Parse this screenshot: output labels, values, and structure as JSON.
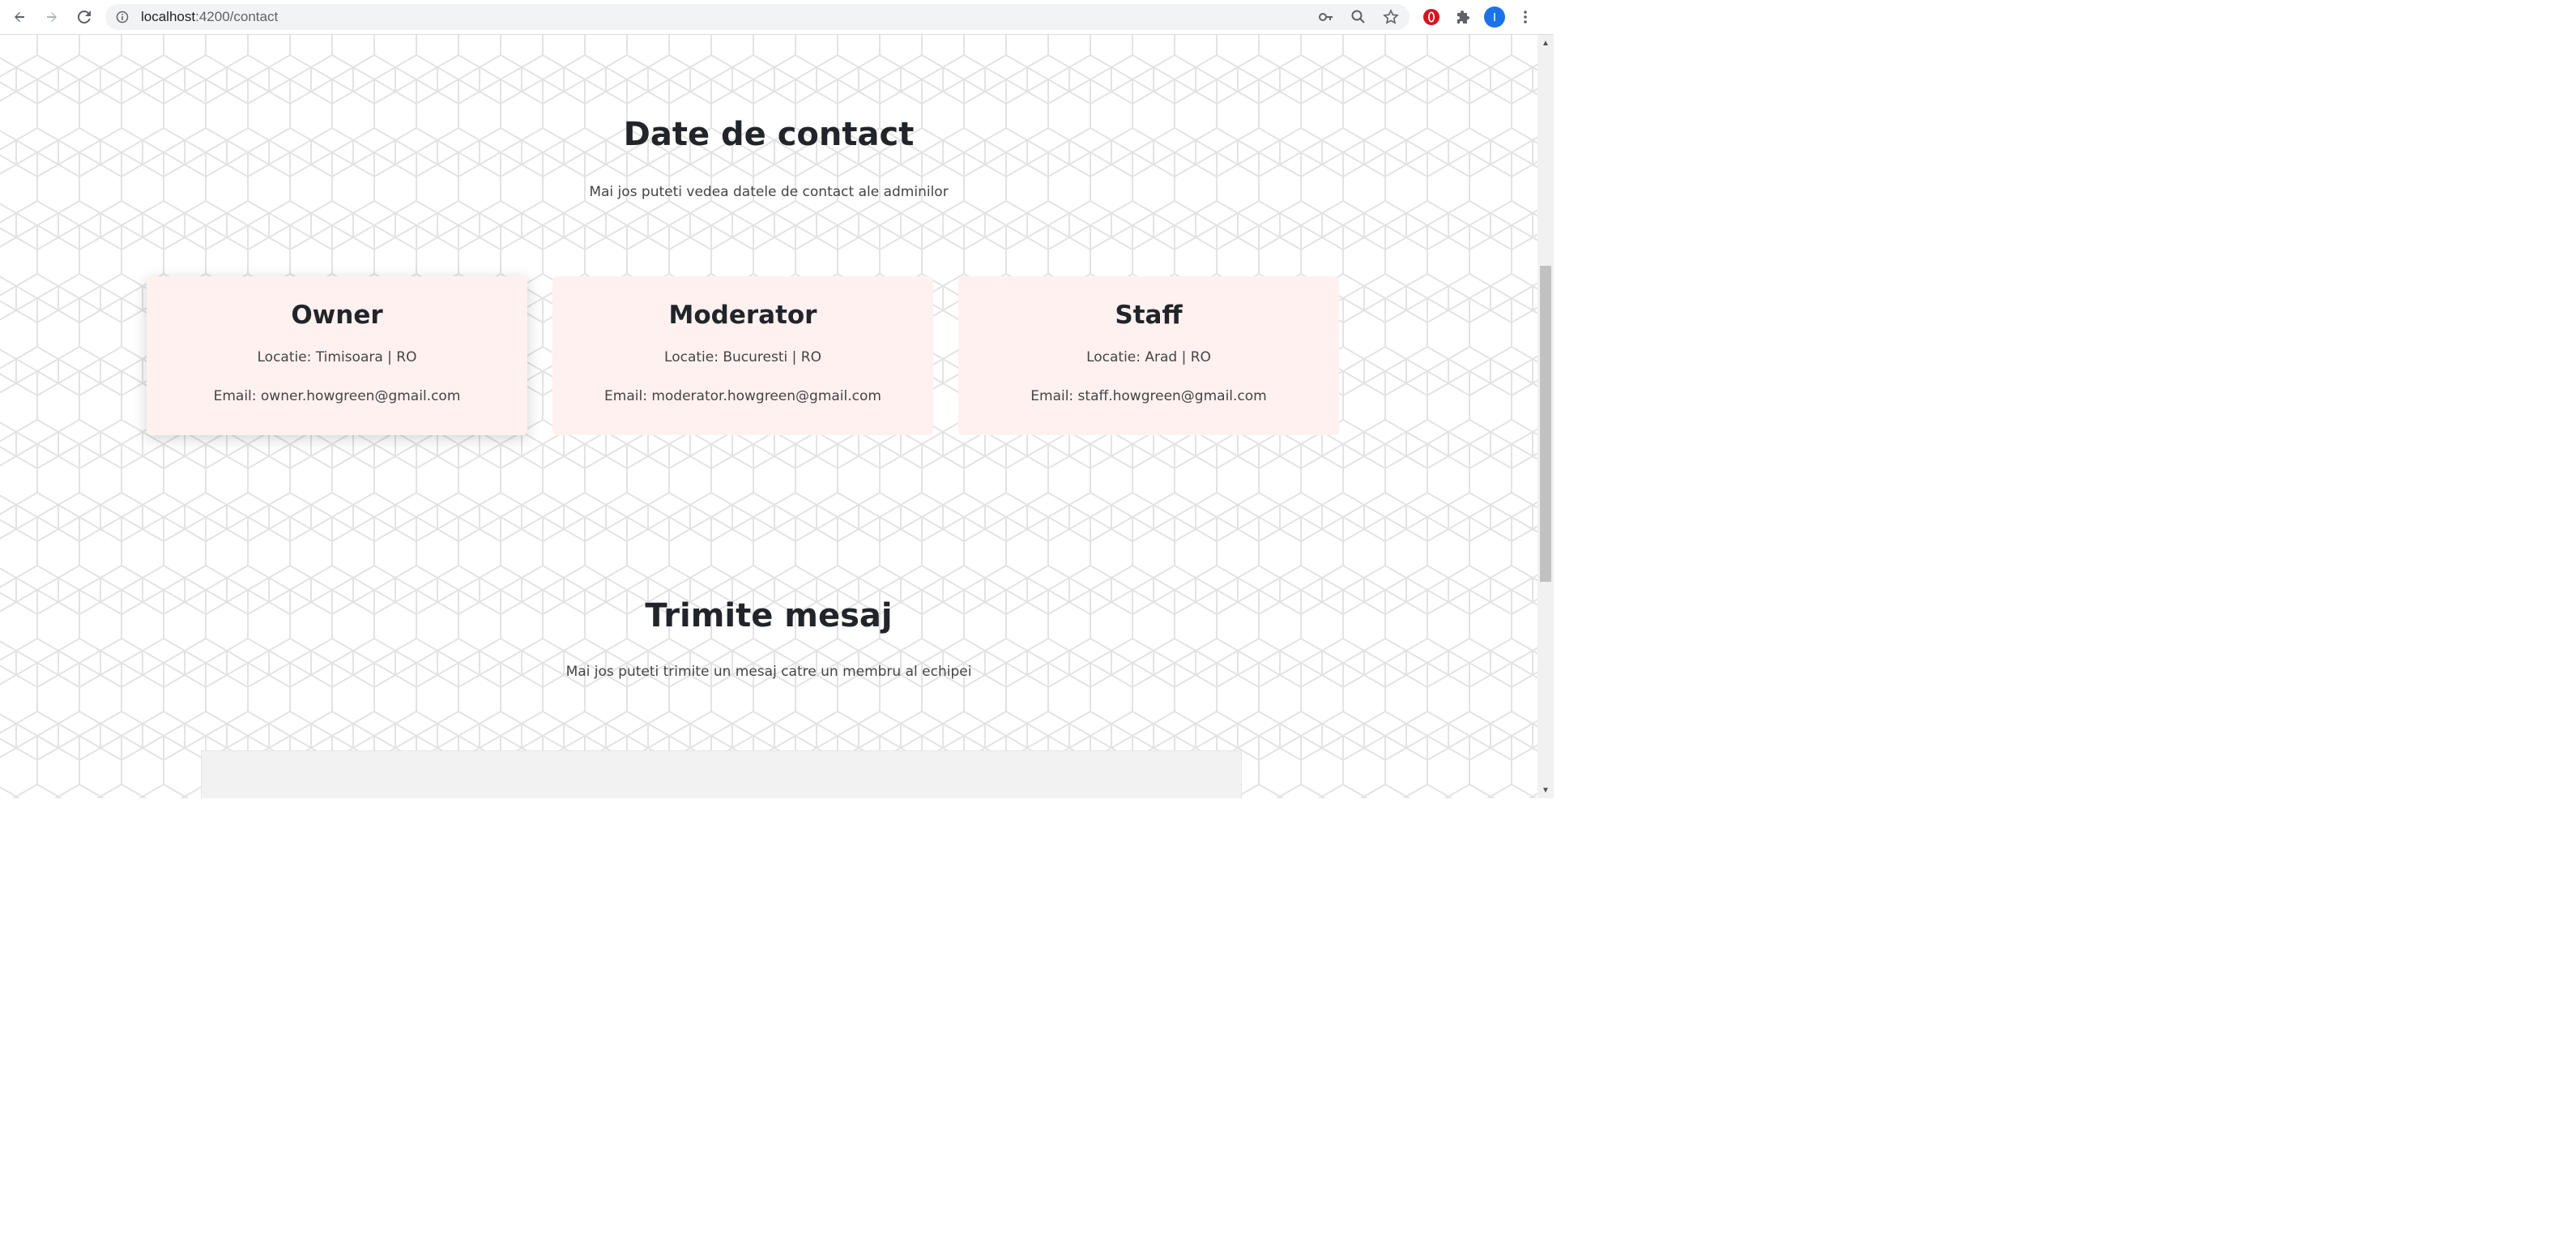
{
  "browser": {
    "url_host": "localhost",
    "url_path": ":4200/contact",
    "avatar_letter": "I"
  },
  "contact": {
    "title": "Date de contact",
    "subtitle": "Mai jos puteti vedea datele de contact ale adminilor",
    "cards": [
      {
        "role": "Owner",
        "location": "Locatie: Timisoara | RO",
        "email": "Email: owner.howgreen@gmail.com"
      },
      {
        "role": "Moderator",
        "location": "Locatie: Bucuresti | RO",
        "email": "Email: moderator.howgreen@gmail.com"
      },
      {
        "role": "Staff",
        "location": "Locatie: Arad | RO",
        "email": "Email: staff.howgreen@gmail.com"
      }
    ]
  },
  "message": {
    "title": "Trimite mesaj",
    "subtitle": "Mai jos puteti trimite un mesaj catre un membru al echipei"
  },
  "colors": {
    "card_bg": "#fff1f0",
    "heading": "#212529",
    "text": "#444444",
    "hex_line": "#e3e3e3"
  },
  "icons": {
    "back": "arrow-left-icon",
    "forward": "arrow-right-icon",
    "reload": "reload-icon",
    "info": "info-icon",
    "key": "key-icon",
    "zoom": "zoom-icon",
    "bookmark": "star-icon",
    "opera": "opera-extension-icon",
    "extensions": "puzzle-icon",
    "menu": "kebab-menu-icon"
  }
}
